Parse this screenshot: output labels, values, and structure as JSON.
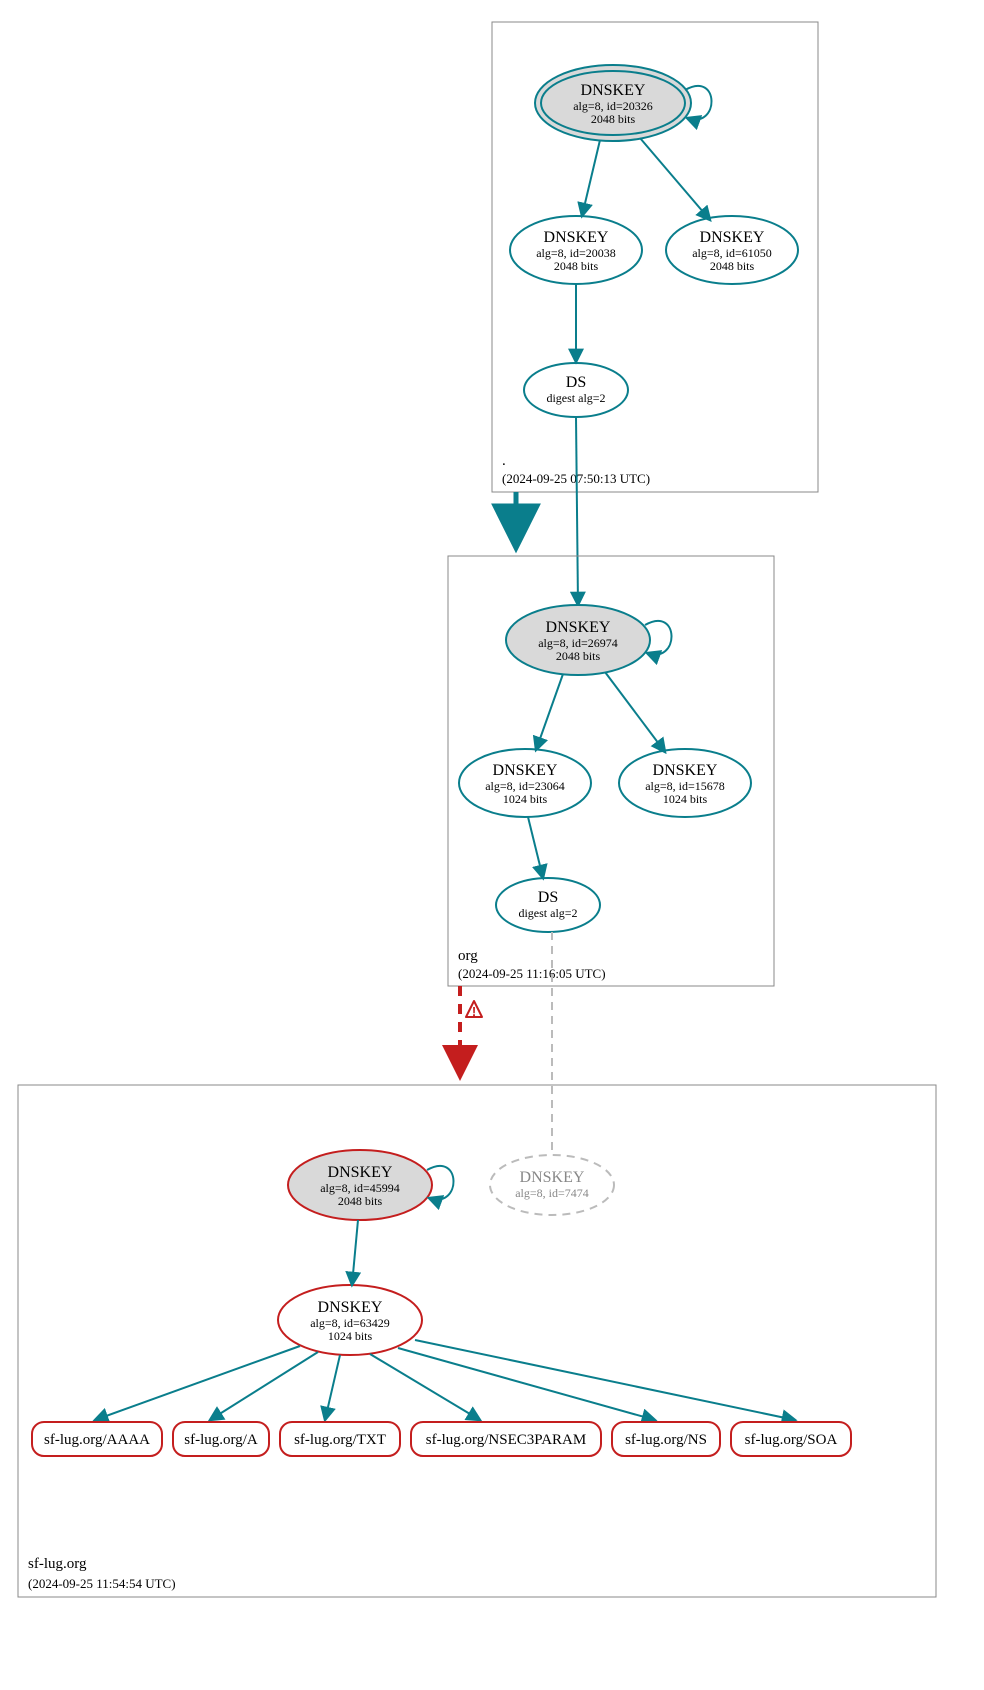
{
  "colors": {
    "teal": "#0a7e8c",
    "red": "#c41e1e",
    "grey_fill": "#d9d9d9",
    "grey_stroke": "#888",
    "light_dash": "#bbb"
  },
  "zones": {
    "root": {
      "label": ".",
      "timestamp": "(2024-09-25 07:50:13 UTC)",
      "nodes": {
        "ksk": {
          "title": "DNSKEY",
          "sub1": "alg=8, id=20326",
          "sub2": "2048 bits"
        },
        "zsk1": {
          "title": "DNSKEY",
          "sub1": "alg=8, id=20038",
          "sub2": "2048 bits"
        },
        "zsk2": {
          "title": "DNSKEY",
          "sub1": "alg=8, id=61050",
          "sub2": "2048 bits"
        },
        "ds": {
          "title": "DS",
          "sub1": "digest alg=2"
        }
      }
    },
    "org": {
      "label": "org",
      "timestamp": "(2024-09-25 11:16:05 UTC)",
      "nodes": {
        "ksk": {
          "title": "DNSKEY",
          "sub1": "alg=8, id=26974",
          "sub2": "2048 bits"
        },
        "zsk1": {
          "title": "DNSKEY",
          "sub1": "alg=8, id=23064",
          "sub2": "1024 bits"
        },
        "zsk2": {
          "title": "DNSKEY",
          "sub1": "alg=8, id=15678",
          "sub2": "1024 bits"
        },
        "ds": {
          "title": "DS",
          "sub1": "digest alg=2"
        }
      }
    },
    "sflug": {
      "label": "sf-lug.org",
      "timestamp": "(2024-09-25 11:54:54 UTC)",
      "nodes": {
        "ksk": {
          "title": "DNSKEY",
          "sub1": "alg=8, id=45994",
          "sub2": "2048 bits"
        },
        "ghost": {
          "title": "DNSKEY",
          "sub1": "alg=8, id=7474"
        },
        "zsk": {
          "title": "DNSKEY",
          "sub1": "alg=8, id=63429",
          "sub2": "1024 bits"
        }
      },
      "rrsets": [
        "sf-lug.org/AAAA",
        "sf-lug.org/A",
        "sf-lug.org/TXT",
        "sf-lug.org/NSEC3PARAM",
        "sf-lug.org/NS",
        "sf-lug.org/SOA"
      ]
    }
  }
}
